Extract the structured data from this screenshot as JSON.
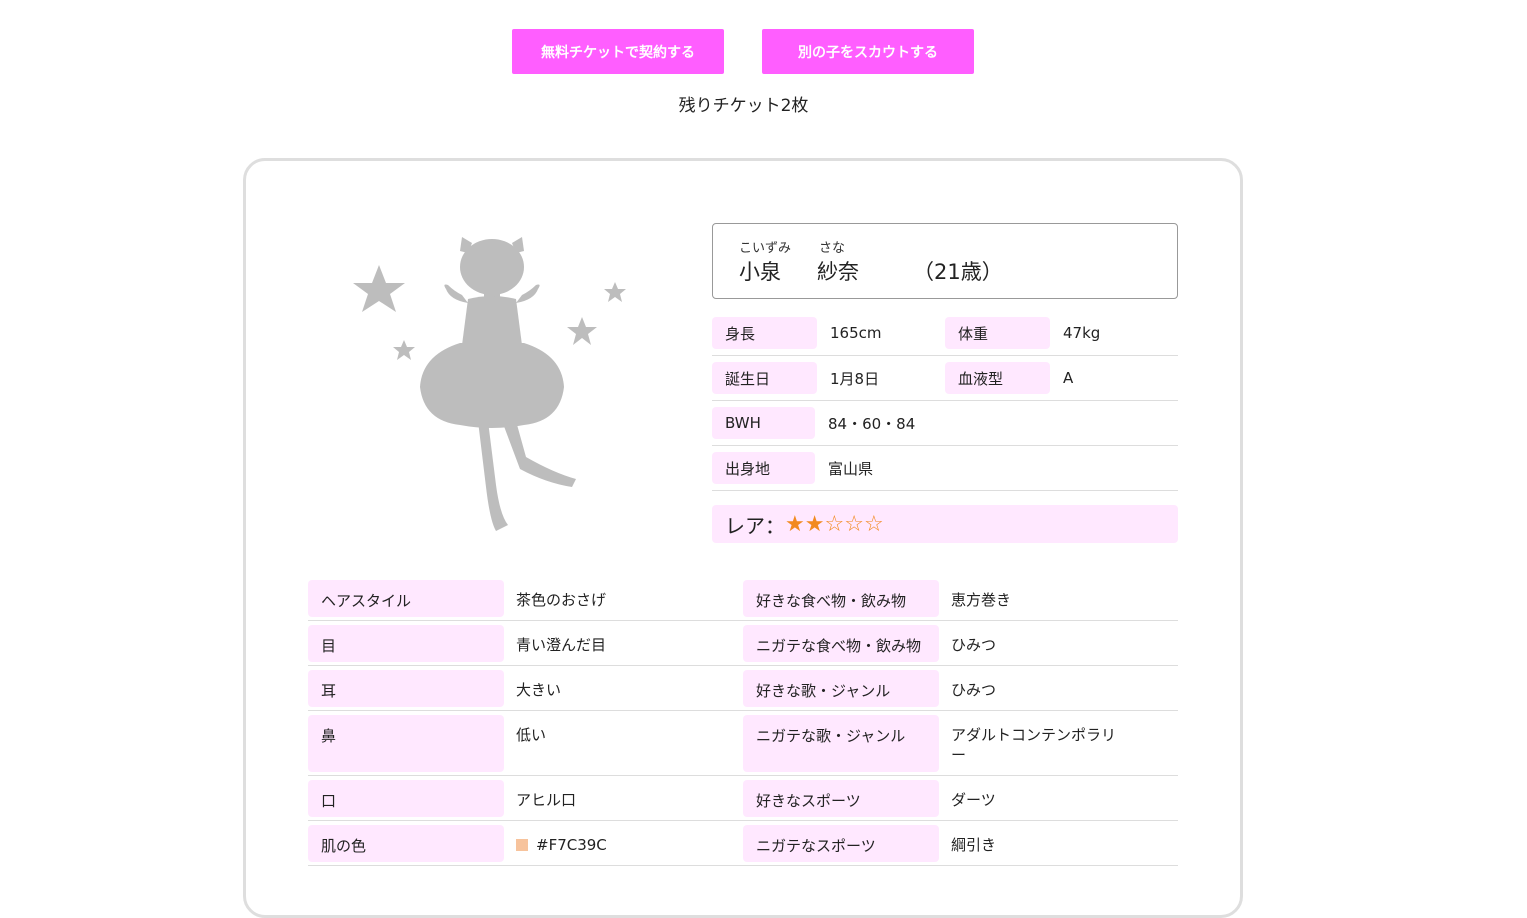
{
  "actions": {
    "contract_label": "無料チケットで契約する",
    "scout_label": "別の子をスカウトする",
    "tickets_remaining": "残りチケット2枚"
  },
  "profile": {
    "surname_ruby": "こいずみ",
    "given_ruby": "さな",
    "surname": "小泉",
    "given": "紗奈",
    "age": "（21歳）",
    "stats": {
      "height_label": "身長",
      "height": "165cm",
      "weight_label": "体重",
      "weight": "47kg",
      "birthday_label": "誕生日",
      "birthday": "1月8日",
      "blood_label": "血液型",
      "blood": "A",
      "bwh_label": "BWH",
      "bwh": "84・60・84",
      "origin_label": "出身地",
      "origin": "富山県"
    },
    "rarity_label": "レア：",
    "rarity_value": 2,
    "rarity_max": 5,
    "star_color": "#f28a1f"
  },
  "details": [
    {
      "l1": "ヘアスタイル",
      "v1": "茶色のおさげ",
      "l2": "好きな食べ物・飲み物",
      "v2": "恵方巻き"
    },
    {
      "l1": "目",
      "v1": "青い澄んだ目",
      "l2": "ニガテな食べ物・飲み物",
      "v2": "ひみつ"
    },
    {
      "l1": "耳",
      "v1": "大きい",
      "l2": "好きな歌・ジャンル",
      "v2": "ひみつ"
    },
    {
      "l1": "鼻",
      "v1": "低い",
      "l2": "ニガテな歌・ジャンル",
      "v2": "アダルトコンテンポラリー"
    },
    {
      "l1": "口",
      "v1": "アヒル口",
      "l2": "好きなスポーツ",
      "v2": "ダーツ"
    },
    {
      "l1": "肌の色",
      "v1": "#F7C39C",
      "l2": "ニガテなスポーツ",
      "v2": "綱引き"
    }
  ],
  "colors": {
    "accent": "#ff5eff",
    "pill_bg": "#ffe8ff",
    "skin_swatch": "#F7C39C"
  }
}
